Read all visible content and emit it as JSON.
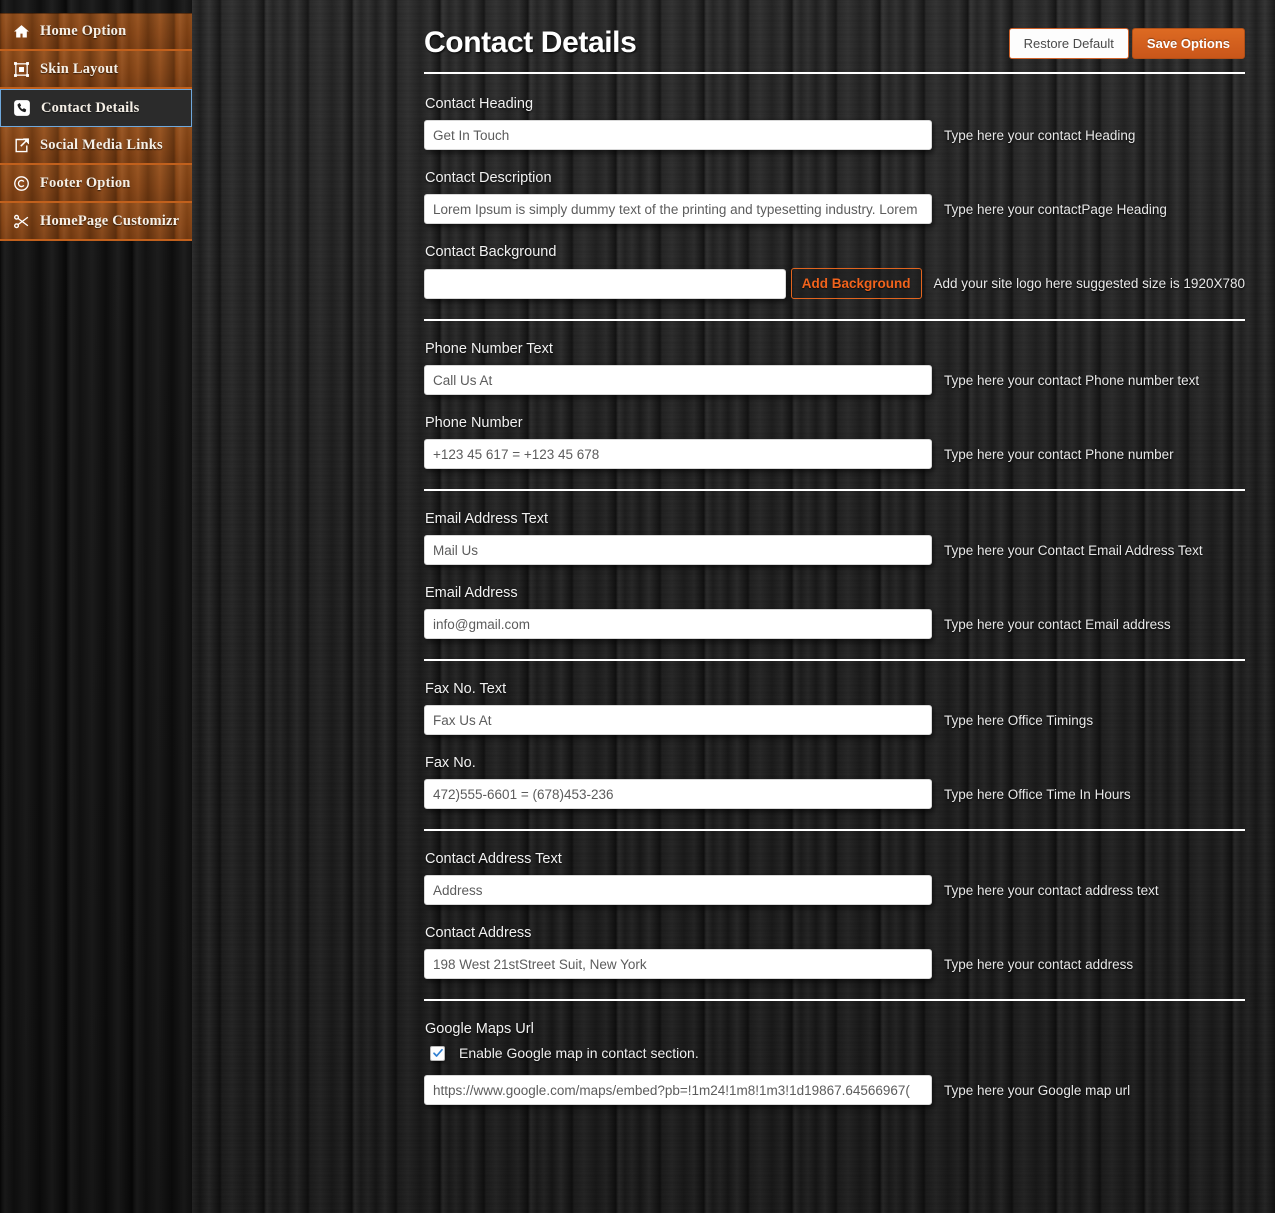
{
  "sidebar": {
    "items": [
      {
        "label": "Home Option",
        "icon": "home-icon",
        "active": false
      },
      {
        "label": "Skin Layout",
        "icon": "crop-icon",
        "active": false
      },
      {
        "label": "Contact Details",
        "icon": "phone-square-icon",
        "active": true
      },
      {
        "label": "Social Media Links",
        "icon": "share-square-icon",
        "active": false
      },
      {
        "label": "Footer Option",
        "icon": "copyright-icon",
        "active": false
      },
      {
        "label": "HomePage Customizr",
        "icon": "scissors-icon",
        "active": false
      }
    ]
  },
  "header": {
    "title": "Contact Details",
    "restore_label": "Restore Default",
    "save_label": "Save Options"
  },
  "colors": {
    "accent_orange": "#d4601d",
    "link_orange": "#f2631c",
    "sidebar_brown": "#8f4a18",
    "active_border_blue": "#6fa8dc"
  },
  "form": {
    "contact_heading": {
      "label": "Contact Heading",
      "value": "Get In Touch",
      "hint": "Type here your contact Heading"
    },
    "contact_description": {
      "label": "Contact Description",
      "value": "Lorem Ipsum is simply dummy text of the printing and typesetting industry. Lorem",
      "hint": "Type here your contactPage Heading"
    },
    "contact_background": {
      "label": "Contact Background",
      "value": "",
      "button_label": "Add Background",
      "hint": "Add your site logo here suggested size is 1920X780"
    },
    "phone_number_text": {
      "label": "Phone Number Text",
      "value": "Call Us At",
      "hint": "Type here your contact Phone number text"
    },
    "phone_number": {
      "label": "Phone Number",
      "value": "+123 45 617 = +123 45 678",
      "hint": "Type here your contact Phone number"
    },
    "email_address_text": {
      "label": "Email Address Text",
      "value": "Mail Us",
      "hint": "Type here your Contact Email Address Text"
    },
    "email_address": {
      "label": "Email Address",
      "value": "info@gmail.com",
      "hint": "Type here your contact Email address"
    },
    "fax_no_text": {
      "label": "Fax No. Text",
      "value": "Fax Us At",
      "hint": "Type here Office Timings"
    },
    "fax_no": {
      "label": "Fax No.",
      "value": "472)555-6601 = (678)453-236",
      "hint": "Type here Office Time In Hours"
    },
    "contact_address_text": {
      "label": "Contact Address Text",
      "value": "Address",
      "hint": "Type here your contact address text"
    },
    "contact_address": {
      "label": "Contact Address",
      "value": "198 West 21stStreet Suit, New York",
      "hint": "Type here your contact address"
    },
    "google_maps_url": {
      "label": "Google Maps Url",
      "checkbox_label": "Enable Google map in contact section.",
      "checkbox_checked": true,
      "value": "https://www.google.com/maps/embed?pb=!1m24!1m8!1m3!1d19867.64566967(",
      "hint": "Type here your Google map url"
    }
  }
}
